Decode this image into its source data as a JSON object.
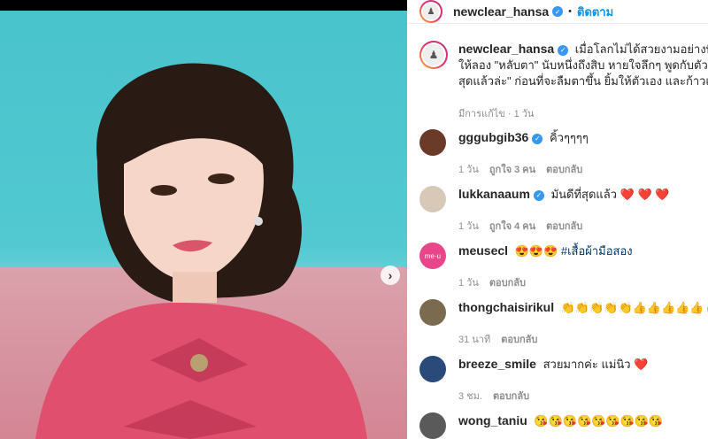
{
  "post": {
    "username": "newclear_hansa",
    "follow_label": "ติดตาม",
    "dot": "•",
    "caption_line1": "เมื่อโลกไม่ได้สวยงามอย่างที่คิด",
    "caption_line2": "ให้ลอง \"หลับตา\" นับหนึ่งถึงสิบ หายใจลึกๆ พูดกับตัวเองว่า",
    "caption_line3": "สุดแล้วล่ะ\" ก่อนที่จะลืมตาขึ้น ยิ้มให้ตัวเอง และก้าวเดินต่อไ",
    "edited": "มีการแก้ไข · 1 วัน"
  },
  "comments": [
    {
      "user": "gggubgib36",
      "verified": true,
      "text": "คิ้วๆๆๆๆ",
      "time": "1 วัน",
      "likes": "ถูกใจ 3 คน",
      "reply": "ตอบกลับ",
      "avatar_color": "#6b3b2a"
    },
    {
      "user": "lukkanaaum",
      "verified": true,
      "text": "มันดีที่สุดแล้ว ❤️ ❤️ ❤️",
      "time": "1 วัน",
      "likes": "ถูกใจ 4 คน",
      "reply": "ตอบกลับ",
      "avatar_color": "#d8c8b8"
    },
    {
      "user": "meusecl",
      "verified": false,
      "text": "😍😍😍 #เสื้อผ้ามือสอง",
      "time": "1 วัน",
      "likes": "",
      "reply": "ตอบกลับ",
      "avatar_color": "#e8458a"
    },
    {
      "user": "thongchaisirikul",
      "verified": false,
      "text": "👏👏👏👏👏👍👍👍👍👍✌️",
      "time": "31 นาที",
      "likes": "",
      "reply": "ตอบกลับ",
      "avatar_color": "#7a6a50"
    },
    {
      "user": "breeze_smile",
      "verified": false,
      "text": "สวยมากค่ะ แม่นิว ❤️",
      "time": "3 ชม.",
      "likes": "",
      "reply": "ตอบกลับ",
      "avatar_color": "#2a4a7a"
    },
    {
      "user": "wong_taniu",
      "verified": false,
      "text": "😘😘😘😘😘😘😘😘😘",
      "time": "",
      "likes": "",
      "reply": "",
      "avatar_color": "#5a5a5a"
    }
  ],
  "colors": {
    "accent": "#0095f6",
    "verified": "#3897f0",
    "heart": "#ed4956"
  }
}
